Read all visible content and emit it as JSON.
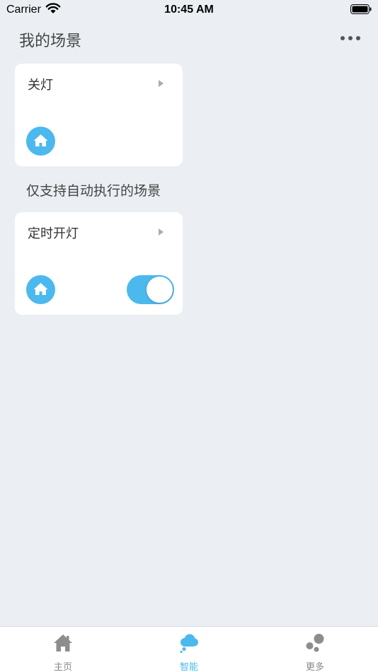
{
  "status_bar": {
    "carrier": "Carrier",
    "time": "10:45 AM"
  },
  "header": {
    "title": "我的场景",
    "more_icon": "more-dots-icon"
  },
  "scenes": [
    {
      "title": "关灯",
      "icon": "home-icon",
      "has_toggle": false
    },
    {
      "title": "定时开灯",
      "icon": "home-icon",
      "has_toggle": true,
      "toggle_on": true
    }
  ],
  "section_label": "仅支持自动执行的场景",
  "tabs": [
    {
      "label": "主页",
      "icon": "home-tab-icon",
      "active": false
    },
    {
      "label": "智能",
      "icon": "cloud-tab-icon",
      "active": true
    },
    {
      "label": "更多",
      "icon": "bubbles-tab-icon",
      "active": false
    }
  ],
  "colors": {
    "accent": "#4bb9ed",
    "background": "#ebeff3",
    "card": "#ffffff",
    "inactive_tab": "#888888"
  }
}
